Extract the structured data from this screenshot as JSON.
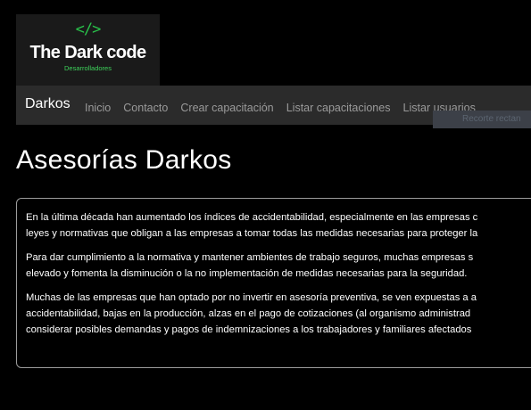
{
  "logo": {
    "icon": "</>",
    "title": "The Dark code",
    "subtitle": "Desarrolladores",
    "icon_color": "#29c24a"
  },
  "navbar": {
    "brand": "Darkos",
    "links": [
      "Inicio",
      "Contacto",
      "Crear capacitación",
      "Listar capacitaciones",
      "Listar usuarios"
    ]
  },
  "overlay": {
    "snip_label": "Recorte rectan"
  },
  "main": {
    "title": "Asesorías Darkos",
    "paragraphs": [
      {
        "lines": [
          "En la última década han aumentado los índices de accidentabilidad, especialmente en las empresas c",
          "leyes y normativas que obligan a las empresas a tomar todas las medidas necesarias para proteger la"
        ]
      },
      {
        "lines": [
          "Para dar cumplimiento a la normativa y mantener ambientes de trabajo seguros, muchas empresas s",
          "elevado y fomenta la disminución o la no implementación de medidas necesarias para la seguridad."
        ]
      },
      {
        "lines": [
          "Muchas de las empresas que han optado por no invertir en asesoría preventiva, se ven expuestas a a",
          "accidentabilidad, bajas en la producción, alzas en el pago de cotizaciones (al organismo administrad",
          "considerar posibles demandas y pagos de indemnizaciones a los trabajadores y familiares afectados"
        ]
      }
    ]
  }
}
